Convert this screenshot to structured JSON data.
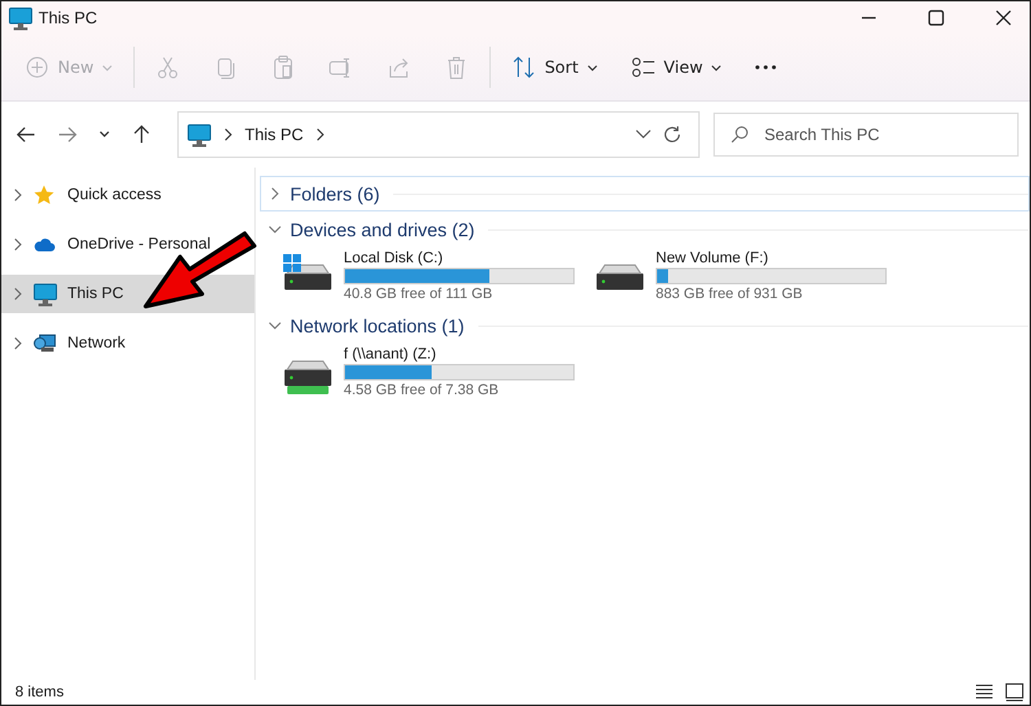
{
  "window": {
    "title": "This PC"
  },
  "toolbar": [
    {
      "kind": "new",
      "label": "New",
      "disabled": true,
      "has_menu": true
    },
    {
      "kind": "cut",
      "disabled": true
    },
    {
      "kind": "copy",
      "disabled": true
    },
    {
      "kind": "paste",
      "disabled": true
    },
    {
      "kind": "rename",
      "disabled": true
    },
    {
      "kind": "share",
      "disabled": true
    },
    {
      "kind": "delete",
      "disabled": true
    },
    {
      "kind": "sort",
      "label": "Sort",
      "disabled": false,
      "has_menu": true
    },
    {
      "kind": "view",
      "label": "View",
      "disabled": false,
      "has_menu": true
    },
    {
      "kind": "more"
    }
  ],
  "address": {
    "crumbs": [
      "This PC"
    ]
  },
  "search": {
    "placeholder": "Search This PC"
  },
  "sidebar": {
    "items": [
      {
        "kind": "star",
        "label": "Quick access",
        "selected": false,
        "expanded": false
      },
      {
        "kind": "cloud",
        "label": "OneDrive - Personal",
        "selected": false,
        "expanded": false
      },
      {
        "kind": "pc",
        "label": "This PC",
        "selected": true,
        "expanded": false
      },
      {
        "kind": "network",
        "label": "Network",
        "selected": false,
        "expanded": false
      }
    ]
  },
  "sections": [
    {
      "title": "Folders (6)",
      "expanded": false,
      "focused": true
    },
    {
      "title": "Devices and drives (2)",
      "expanded": true,
      "focused": false,
      "drives": [
        {
          "kind": "system",
          "name": "Local Disk (C:)",
          "level": 0.63,
          "free": "40.8 GB free of 111 GB"
        },
        {
          "kind": "local",
          "name": "New Volume (F:)",
          "level": 0.05,
          "free": "883 GB free of 931 GB"
        }
      ]
    },
    {
      "title": "Network locations (1)",
      "expanded": true,
      "focused": false,
      "drives": [
        {
          "kind": "network",
          "name": "f (\\\\anant) (Z:)",
          "level": 0.38,
          "free": "4.58 GB free of 7.38 GB"
        }
      ]
    }
  ],
  "status_bar": {
    "count": "8 items"
  }
}
